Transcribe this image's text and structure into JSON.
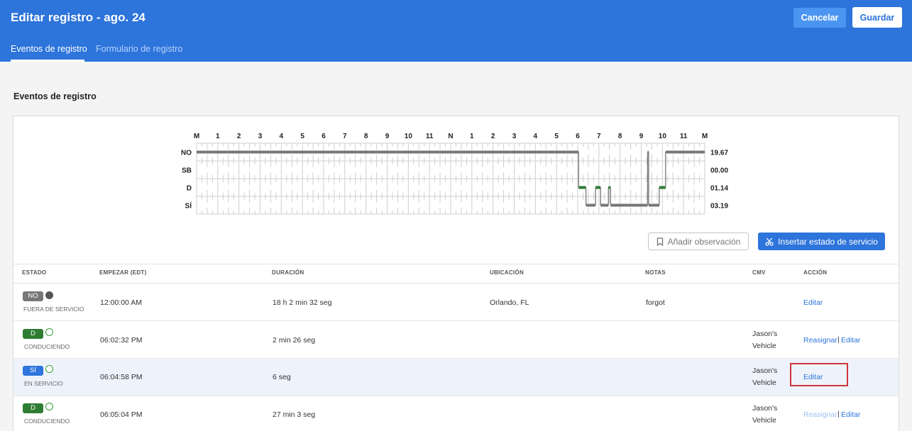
{
  "header": {
    "title": "Editar registro - ago. 24",
    "cancel_label": "Cancelar",
    "save_label": "Guardar",
    "tabs": [
      {
        "label": "Eventos de registro",
        "active": true
      },
      {
        "label": "Formulario de registro",
        "active": false
      }
    ]
  },
  "section_title": "Eventos de registro",
  "chart_data": {
    "type": "duty-status-grid",
    "hour_labels": [
      "M",
      "1",
      "2",
      "3",
      "4",
      "5",
      "6",
      "7",
      "8",
      "9",
      "10",
      "11",
      "N",
      "1",
      "2",
      "3",
      "4",
      "5",
      "6",
      "7",
      "8",
      "9",
      "10",
      "11",
      "M"
    ],
    "rows": [
      {
        "label": "NO",
        "total": "19.67"
      },
      {
        "label": "SB",
        "total": "00.00"
      },
      {
        "label": "D",
        "total": "01.14"
      },
      {
        "label": "SÍ",
        "total": "03.19"
      }
    ],
    "colors": {
      "line": "#777777",
      "driving": "#2e7d32",
      "grid": "#cfcfcf"
    }
  },
  "actions": {
    "add_observation_label": "Añadir observación",
    "insert_status_label": "Insertar estado de servicio"
  },
  "table": {
    "columns": [
      "ESTADO",
      "EMPEZAR (EDT)",
      "DURACIÓN",
      "UBICACIÓN",
      "NOTAS",
      "CMV",
      "ACCIÓN"
    ],
    "rows": [
      {
        "badge": "NO",
        "status": "FUERA DE SERVICIO",
        "start": "12:00:00 AM",
        "duration": "18 h 2 min 32 seg",
        "location": "Orlando, FL",
        "notes": "forgot",
        "cmv1": "",
        "cmv2": "",
        "reassign": "",
        "edit": "Editar"
      },
      {
        "badge": "D",
        "status": "CONDUCIENDO",
        "start": "06:02:32 PM",
        "duration": "2 min 26 seg",
        "location": "",
        "notes": "",
        "cmv1": "Jason's",
        "cmv2": "Vehicle",
        "reassign": "Reasignar",
        "edit": "Editar"
      },
      {
        "badge": "SÍ",
        "status": "EN SERVICIO",
        "start": "06:04:58 PM",
        "duration": "6 seg",
        "location": "",
        "notes": "",
        "cmv1": "Jason's",
        "cmv2": "Vehicle",
        "reassign": "",
        "edit": "Editar"
      },
      {
        "badge": "D",
        "status": "CONDUCIENDO",
        "start": "06:05:04 PM",
        "duration": "27 min 3 seg",
        "location": "",
        "notes": "",
        "cmv1": "Jason's",
        "cmv2": "Vehicle",
        "reassign": "Reasignar",
        "edit": "Editar"
      }
    ]
  }
}
